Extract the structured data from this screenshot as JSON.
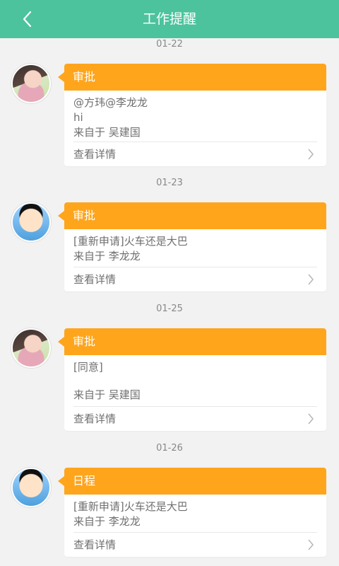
{
  "header": {
    "title": "工作提醒",
    "back_icon": "chevron-left-icon"
  },
  "colors": {
    "header_bg": "#4cc39d",
    "card_head_bg": "#ffa51c"
  },
  "groups": [
    {
      "date": "01-22",
      "type": "审批",
      "lines": [
        "@方玮@李龙龙",
        "hi",
        "来自于 吴建国"
      ],
      "action": "查看详情"
    },
    {
      "date": "01-23",
      "type": "审批",
      "lines": [
        "[重新申请]火车还是大巴",
        "来自于 李龙龙"
      ],
      "action": "查看详情"
    },
    {
      "date": "01-25",
      "type": "审批",
      "lines": [
        "[同意]",
        "来自于 吴建国"
      ],
      "action": "查看详情"
    },
    {
      "date": "01-26",
      "type": "日程",
      "lines": [
        "[重新申请]火车还是大巴",
        "来自于 李龙龙"
      ],
      "action": "查看详情"
    }
  ]
}
